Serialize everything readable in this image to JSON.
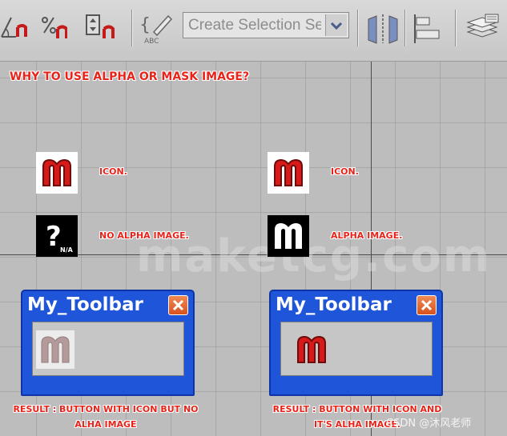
{
  "toolbar": {
    "selection_set_placeholder": "Create Selection Se",
    "icons": [
      "angle-snap-icon",
      "percent-snap-icon",
      "spinner-snap-icon",
      "edit-named-selection-icon",
      "mirror-icon",
      "align-icon",
      "layer-manager-icon"
    ]
  },
  "heading": "WHY TO USE ALPHA OR MASK IMAGE?",
  "watermark": "maketcg.com",
  "left_column": {
    "icon_label": "ICON.",
    "alpha_label": "NO ALPHA IMAGE.",
    "na_text": "N/A",
    "window_title": "My_Toolbar",
    "result_line1": "RESULT : BUTTON WITH ICON BUT NO",
    "result_line2": "ALHA IMAGE"
  },
  "right_column": {
    "icon_label": "ICON.",
    "alpha_label": "ALPHA IMAGE.",
    "window_title": "My_Toolbar",
    "result_line1": "RESULT : BUTTON WITH ICON AND",
    "result_line2": "IT'S ALHA IMAGE."
  },
  "colors": {
    "accent_red": "#e8231a",
    "window_blue": "#1f55d8",
    "close_orange": "#e0622a"
  },
  "credit": "CSDN @沐风老师"
}
